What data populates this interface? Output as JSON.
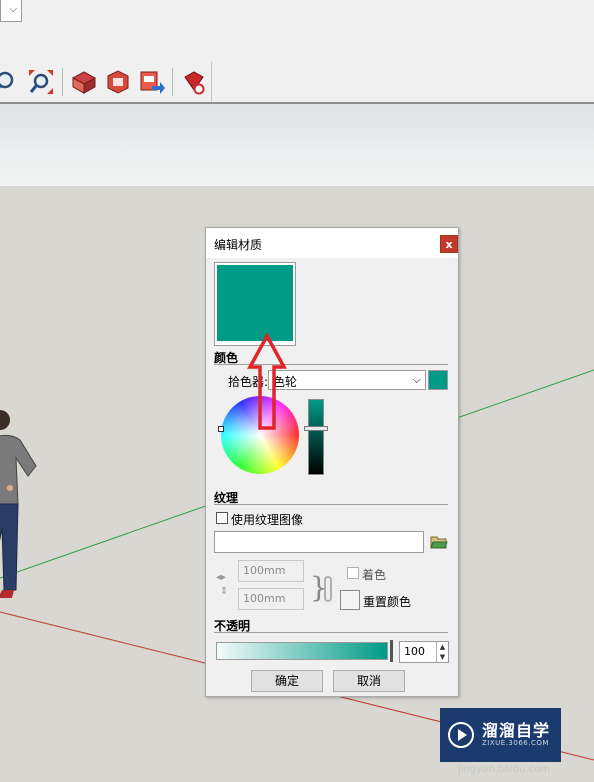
{
  "dialog": {
    "title": "编辑材质",
    "close_label": "x",
    "material_color": "#009b87",
    "color_section": {
      "title": "颜色",
      "picker_label": "拾色器:",
      "picker_value": "色轮"
    },
    "texture_section": {
      "title": "纹理",
      "use_texture_label": "使用纹理图像",
      "use_texture_checked": false,
      "path_value": "",
      "width_value": "100mm",
      "height_value": "100mm",
      "colorize_label": "着色",
      "reset_color_label": "重置颜色"
    },
    "opacity_section": {
      "title": "不透明",
      "value": "100"
    },
    "ok_label": "确定",
    "cancel_label": "取消"
  },
  "toolbar": {
    "icons": [
      "zoom-icon",
      "zoom-extents-icon",
      "component-icon",
      "3d-warehouse-icon",
      "share-model-icon",
      "extension-warehouse-icon"
    ]
  },
  "watermark": {
    "title": "溜溜自学",
    "subtitle": "ZIXUE.3066.COM",
    "underlay": "jingyan.baidu.com"
  },
  "colors": {
    "accent": "#009b87",
    "close": "#c0392b",
    "annotation_arrow": "#e0242b",
    "green_axis": "#2ea043",
    "red_axis": "#c0392b"
  }
}
